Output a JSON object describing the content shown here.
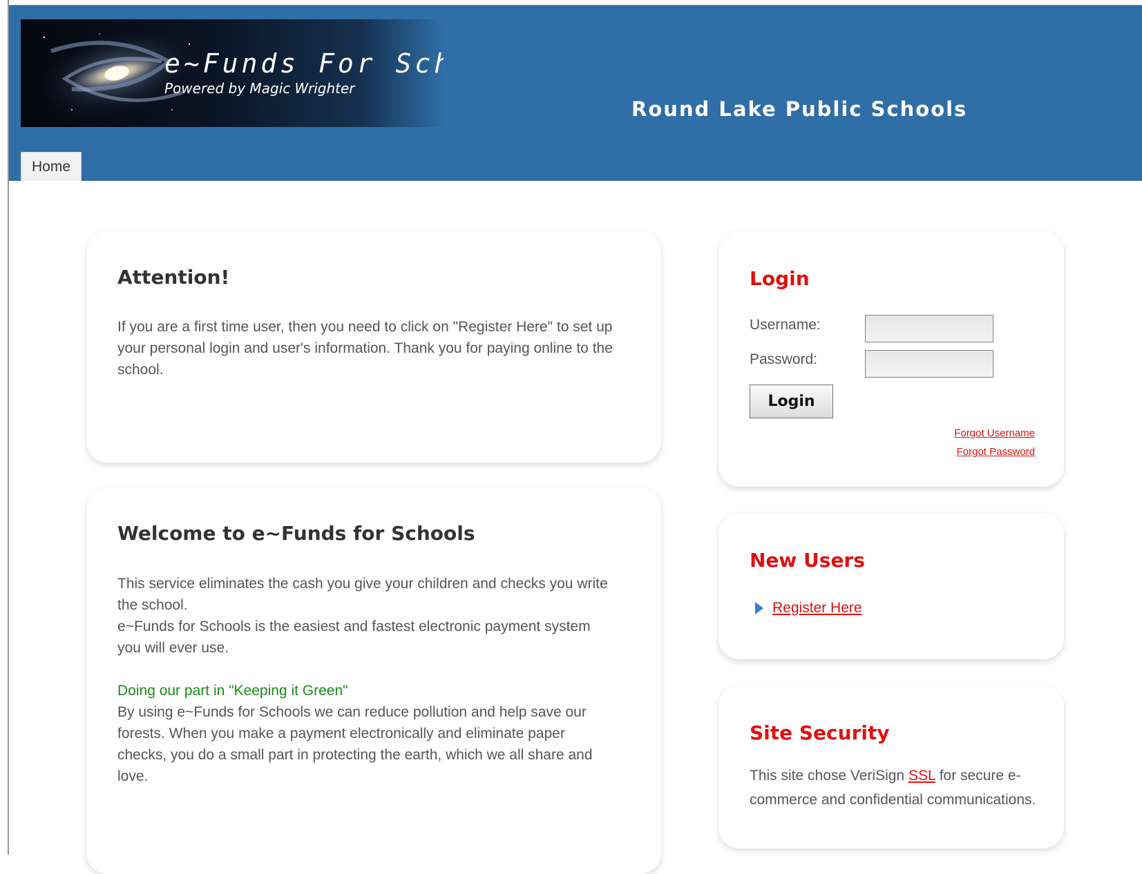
{
  "header": {
    "app_title": "e~Funds For Schools",
    "powered_by": "Powered by Magic Wrighter",
    "school_name": "Round Lake Public Schools"
  },
  "nav": {
    "tabs": [
      {
        "label": "Home"
      }
    ]
  },
  "attention": {
    "heading": "Attention!",
    "text": "If you are a first time user, then you need to click on \"Register Here\" to set up your personal login and user's information. Thank you for paying online to the school."
  },
  "welcome": {
    "heading": "Welcome to e~Funds for Schools",
    "line1": "This service eliminates the cash you give your children and checks you write the school.",
    "line2": "e~Funds for Schools is the easiest and fastest electronic payment system you will ever use.",
    "green_heading": "Doing our part in \"Keeping it Green\"",
    "green_text": "By using e~Funds for Schools we can reduce pollution and help save our forests. When you make a payment electronically and eliminate paper checks, you do a small part in protecting the earth, which we all share and love."
  },
  "login": {
    "heading": "Login",
    "username_label": "Username:",
    "password_label": "Password:",
    "username_value": "",
    "password_value": "",
    "button_label": "Login",
    "forgot_username": "Forgot Username",
    "forgot_password": "Forgot Password"
  },
  "new_users": {
    "heading": "New Users",
    "register_link": "Register Here"
  },
  "security": {
    "heading": "Site Security",
    "text_before": "This site chose VeriSign ",
    "ssl_link": "SSL",
    "text_after": " for secure e-commerce and confidential communications."
  },
  "colors": {
    "header_blue": "#2f6ea6",
    "accent_red": "#e01010",
    "green": "#1a8a1a"
  },
  "icons": {
    "register_bullet": "triangle-right-icon"
  }
}
